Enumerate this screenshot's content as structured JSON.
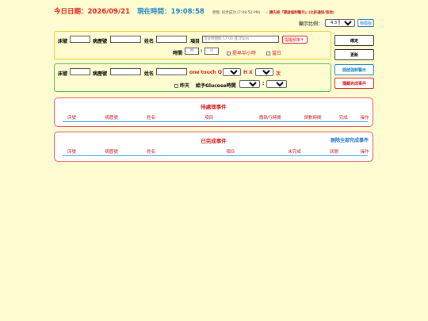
{
  "header": {
    "today": "今日日期：2026/09/21",
    "now": "現在時間：19:08:58",
    "status": "狀態: 同步成功 (7:08:53 PM)",
    "notice_star": "☆",
    "notice": "請先按『開啟強制警示』(允許通知/音效)"
  },
  "display": {
    "ratio_label": "顯示比例：",
    "ratio_value": "4:3 螢幕",
    "simple_label": "簡模版"
  },
  "form1": {
    "bed_label": "床號",
    "chart_label": "病歷號",
    "name_label": "姓名",
    "item_label": "項目",
    "item_placeholder": "可含時間如 17:00 或 05pm",
    "freq_value": "提醒頻率",
    "time_label": "時間",
    "hour_placeholder": "時",
    "minute_placeholder": "分",
    "half_hour_label": "提早半小時",
    "same_day_label": "當日",
    "confirm_label": "確定",
    "update_label": "更新"
  },
  "form2": {
    "bed_label": "床號",
    "chart_label": "病歷號",
    "name_label": "姓名",
    "onetouch_label": "one touch Q",
    "q_value": "2",
    "hx_label": "H X",
    "times_value": "3",
    "times_suffix": "次",
    "yesterday_label": "昨天",
    "glucose_label": "給予Glucose時間",
    "gh_value": "19",
    "gm_value": "08",
    "alert_btn": "開啟強制警示",
    "hide_btn": "隱藏完成事件"
  },
  "pending": {
    "title": "待處理事件",
    "columns": [
      "床號",
      "病歷號",
      "姓名",
      "項目",
      "應執行時間",
      "倒數時間",
      "完成",
      "操作"
    ]
  },
  "done": {
    "title": "已完成事件",
    "delete_all": "刪除全部完成事件",
    "columns": [
      "床號",
      "病歷號",
      "姓名",
      "項目",
      "未完成",
      "狀態",
      "操作"
    ]
  },
  "colors": {
    "red": "#d82020",
    "blue": "#1f86c8",
    "yellow_border": "#e6d02a",
    "green_border": "#58b85a"
  }
}
